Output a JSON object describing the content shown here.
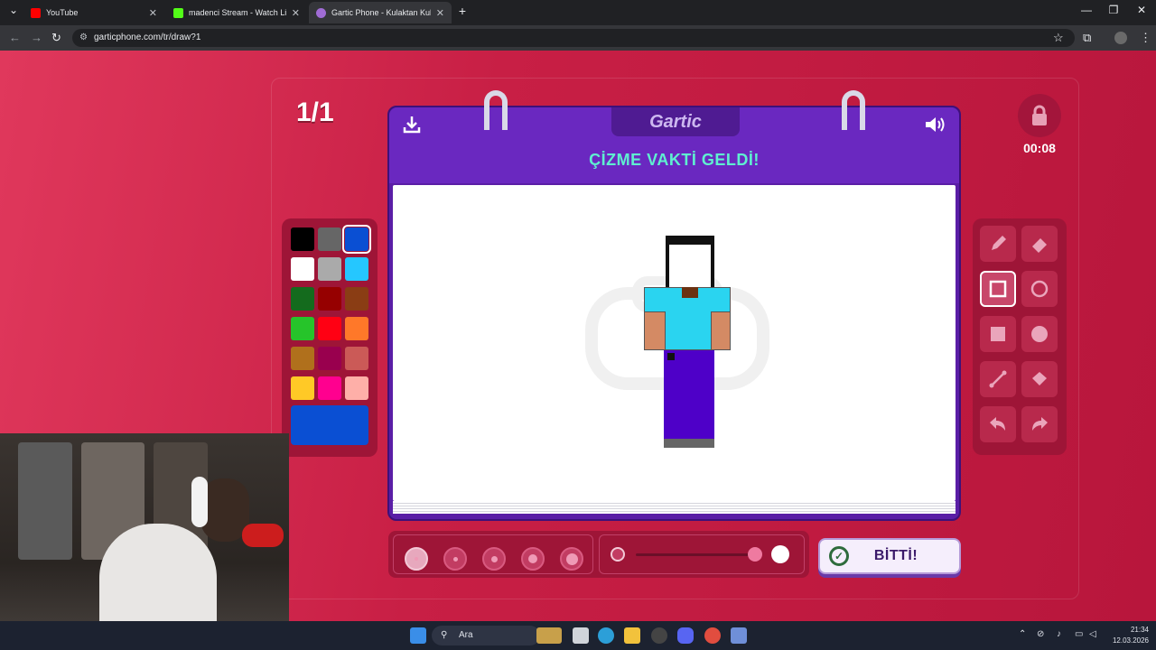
{
  "browser": {
    "tabs": [
      {
        "label": "YouTube",
        "color": "#ff0000",
        "active": false
      },
      {
        "label": "madenci Stream - Watch Live o",
        "color": "#53fc18",
        "active": false
      },
      {
        "label": "Gartic Phone - Kulaktan Kulağa",
        "color": "#a06cd5",
        "active": true
      }
    ],
    "new_tab": "+",
    "url": "garticphone.com/tr/draw?1"
  },
  "game": {
    "round": "1/1",
    "timer": "00:08",
    "logo": "Gartic",
    "title": "ÇİZME VAKTİ GELDİ!",
    "done_label": "BİTTİ!"
  },
  "palette": {
    "colors": [
      "#000000",
      "#666666",
      "#0a4fd3",
      "#ffffff",
      "#aaaaaa",
      "#25c7ff",
      "#146b1d",
      "#960000",
      "#8a3d14",
      "#26c42a",
      "#ff0013",
      "#ff7829",
      "#b0701c",
      "#99004e",
      "#cb5a57",
      "#ffc926",
      "#ff008f",
      "#feafa8"
    ],
    "selected_index": 2,
    "current_color": "#0a4fd3"
  },
  "tools": [
    "pencil",
    "eraser",
    "rectangle-outline",
    "ellipse-outline",
    "rectangle-filled",
    "ellipse-filled",
    "line",
    "fill-bucket",
    "undo",
    "redo"
  ],
  "active_tool": "rectangle-outline",
  "taskbar": {
    "search_label": "Ara",
    "time": "21:34",
    "date": "12.03.2026"
  }
}
